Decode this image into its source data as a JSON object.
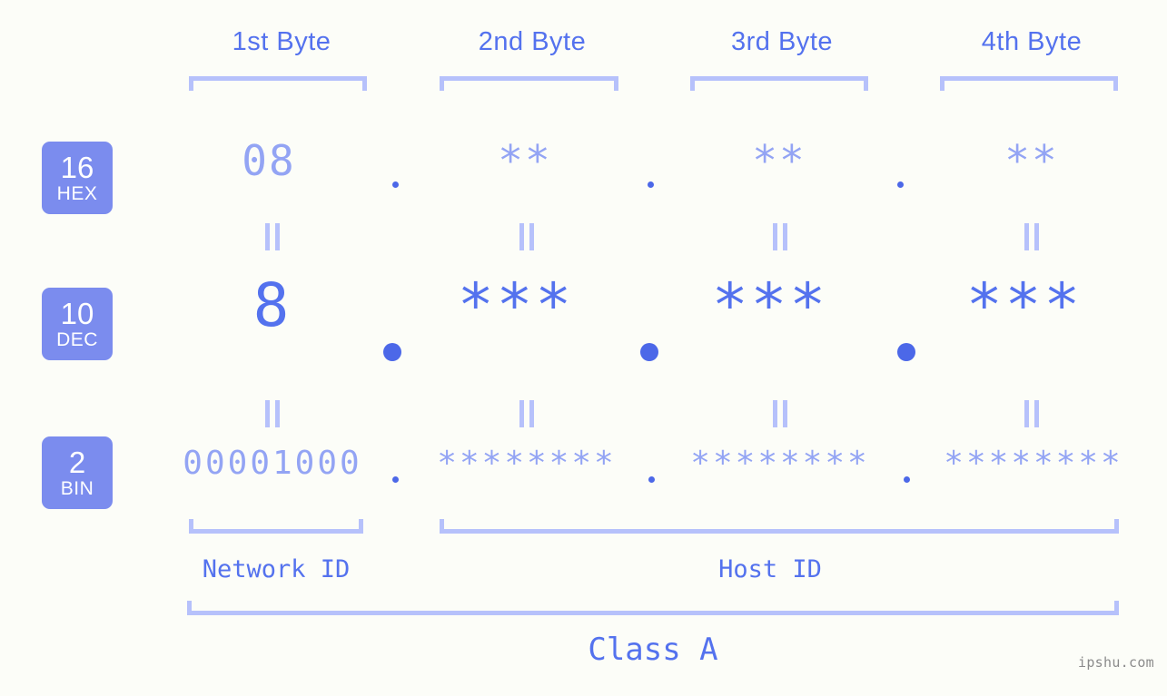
{
  "background_color": "#fcfdf8",
  "accent_color": "#5472ee",
  "accent_light_color": "#93a4f4",
  "bracket_color": "#b6c1fb",
  "badge_color": "#7b8cee",
  "headers": [
    {
      "label": "1st Byte"
    },
    {
      "label": "2nd Byte"
    },
    {
      "label": "3rd Byte"
    },
    {
      "label": "4th Byte"
    }
  ],
  "rows": [
    {
      "badge_num": "16",
      "badge_unit": "HEX",
      "values": [
        "08",
        "**",
        "**",
        "**"
      ],
      "separator": "."
    },
    {
      "badge_num": "10",
      "badge_unit": "DEC",
      "values": [
        "8",
        "***",
        "***",
        "***"
      ],
      "separator": "."
    },
    {
      "badge_num": "2",
      "badge_unit": "BIN",
      "values": [
        "00001000",
        "********",
        "********",
        "********"
      ],
      "separator": "."
    }
  ],
  "equals_glyph": "=",
  "sections": {
    "network_id": "Network ID",
    "host_id": "Host ID",
    "class": "Class A"
  },
  "watermark": "ipshu.com"
}
